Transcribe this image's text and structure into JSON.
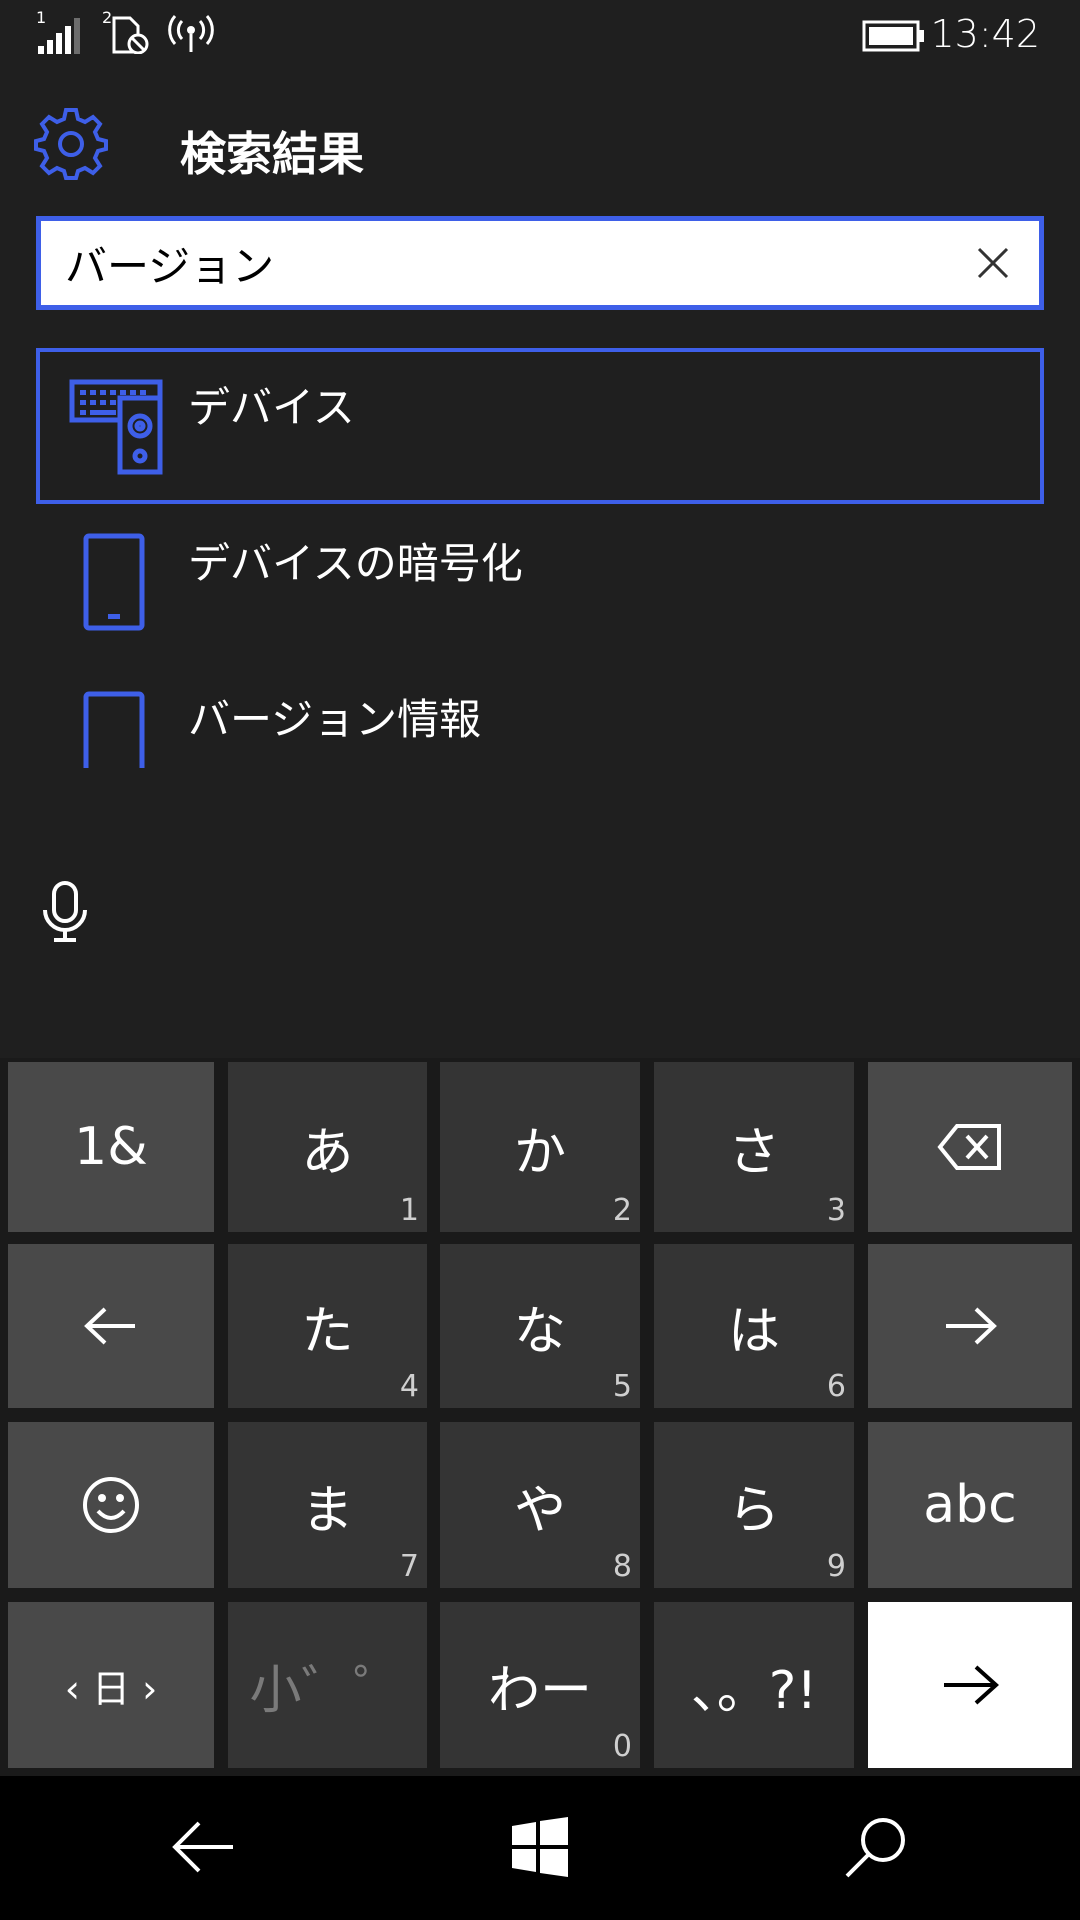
{
  "status_bar": {
    "sim1_label": "1",
    "sim2_label": "2",
    "time": "13:42"
  },
  "header": {
    "title": "検索結果"
  },
  "search": {
    "value": "バージョン"
  },
  "results": [
    {
      "label": "デバイス",
      "icon": "devices-icon",
      "selected": true
    },
    {
      "label": "デバイスの暗号化",
      "icon": "phone-icon",
      "selected": false
    },
    {
      "label": "バージョン情報",
      "icon": "phone-icon",
      "selected": false
    }
  ],
  "keyboard": {
    "rows": [
      [
        {
          "label": "1&",
          "sub": ""
        },
        {
          "label": "あ",
          "sub": "1"
        },
        {
          "label": "か",
          "sub": "2"
        },
        {
          "label": "さ",
          "sub": "3"
        },
        {
          "label": "",
          "sub": "",
          "icon": "backspace-icon"
        }
      ],
      [
        {
          "label": "",
          "sub": "",
          "icon": "arrow-left-icon"
        },
        {
          "label": "た",
          "sub": "4"
        },
        {
          "label": "な",
          "sub": "5"
        },
        {
          "label": "は",
          "sub": "6"
        },
        {
          "label": "",
          "sub": "",
          "icon": "arrow-right-icon"
        }
      ],
      [
        {
          "label": "",
          "sub": "",
          "icon": "emoji-icon"
        },
        {
          "label": "ま",
          "sub": "7"
        },
        {
          "label": "や",
          "sub": "8"
        },
        {
          "label": "ら",
          "sub": "9"
        },
        {
          "label": "abc",
          "sub": ""
        }
      ],
      [
        {
          "label": "‹ 日 ›",
          "sub": ""
        },
        {
          "label": "小゛゜",
          "sub": ""
        },
        {
          "label": "わー",
          "sub": "0"
        },
        {
          "label": "、。?!",
          "sub": ""
        },
        {
          "label": "",
          "sub": "",
          "icon": "enter-arrow-icon"
        }
      ]
    ]
  },
  "colors": {
    "accent": "#3e5fe8",
    "background": "#1f1f1f",
    "key": "#343434",
    "key_function": "#494949"
  }
}
